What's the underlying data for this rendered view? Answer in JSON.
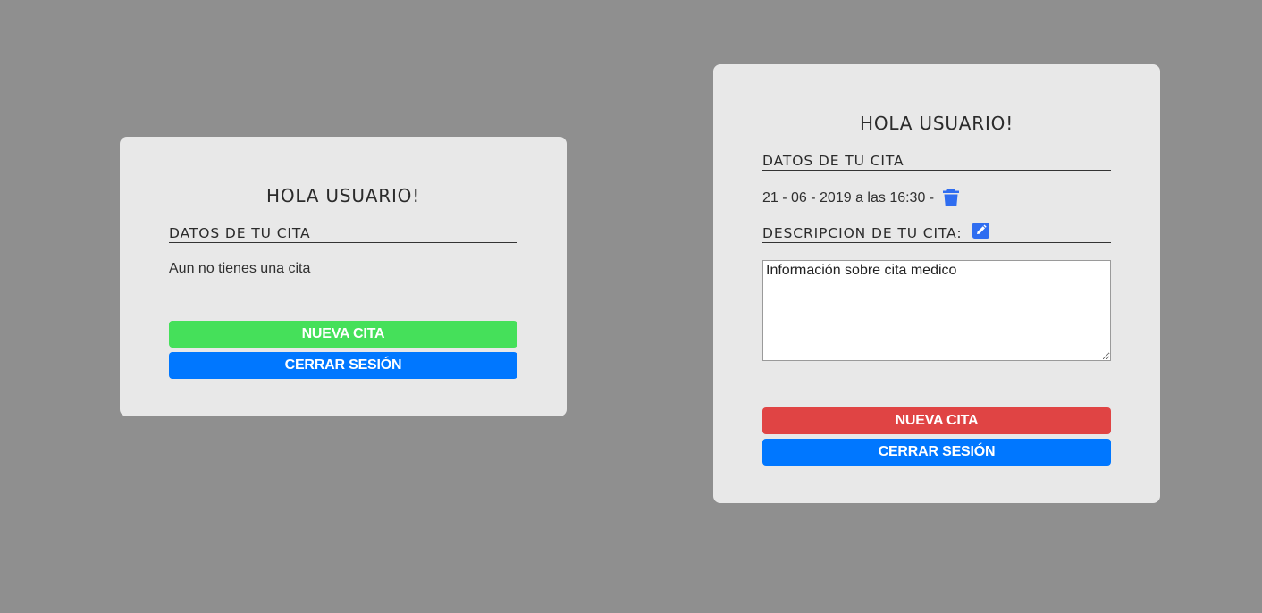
{
  "colors": {
    "background": "#8f8f8f",
    "card": "#e8e8e8",
    "green": "#45e05a",
    "blue": "#0077ff",
    "red": "#e04444",
    "icon_blue": "#2f6df0"
  },
  "card_no_appointment": {
    "title": "HOLA USUARIO!",
    "section_title": "DATOS DE TU CITA",
    "empty_message": "Aun no tienes una cita",
    "new_button": "NUEVA CITA",
    "logout_button": "CERRAR SESIÓN"
  },
  "card_with_appointment": {
    "title": "HOLA USUARIO!",
    "section_title": "DATOS DE TU CITA",
    "appointment_text": "21 - 06 - 2019 a las 16:30 -",
    "delete_icon": "trash-icon",
    "description_title": "DESCRIPCION DE TU CITA:",
    "edit_icon": "edit-icon",
    "description_value": "Información sobre cita medico",
    "new_button": "NUEVA CITA",
    "logout_button": "CERRAR SESIÓN"
  }
}
